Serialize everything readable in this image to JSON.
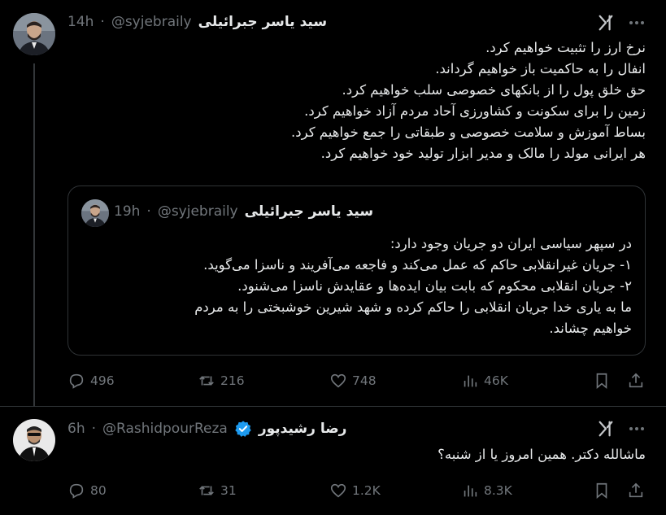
{
  "tweet1": {
    "author_name": "سید یاسر جبرائیلی",
    "handle": "@syjebraily",
    "separator": "·",
    "time": "14h",
    "lines": [
      "نرخ ارز را تثبیت خواهیم کرد.",
      "انفال را به حاکمیت باز خواهیم گرداند.",
      "حق خلق پول را از بانکهای خصوصی سلب خواهیم کرد.",
      "زمین را برای سکونت و کشاورزی آحاد مردم آزاد خواهیم کرد.",
      "بساط آموزش و سلامت خصوصی و طبقاتی را جمع خواهیم کرد.",
      "هر ایرانی مولد را مالک و مدیر ابزار تولید خود خواهیم کرد."
    ],
    "quote": {
      "author_name": "سید یاسر جبرائیلی",
      "handle": "@syjebraily",
      "separator": "·",
      "time": "19h",
      "lines": [
        "در سپهر سیاسی ایران دو جریان وجود دارد:",
        "۱- جریان غیرانقلابی حاکم که عمل می‌کند و فاجعه می‌آفریند و ناسزا می‌گوید.",
        "۲- جریان انقلابی محکوم که بابت بیان ایده‌ها و عقایدش ناسزا می‌شنود.",
        "ما به یاری خدا جریان انقلابی را حاکم کرده و شهد شیرین خوشبختی را به مردم",
        "خواهیم چشاند."
      ]
    },
    "actions": {
      "replies": "496",
      "reposts": "216",
      "likes": "748",
      "views": "46K"
    }
  },
  "tweet2": {
    "author_name": "رضا رشیدپور",
    "handle": "@RashidpourReza",
    "separator": "·",
    "time": "6h",
    "text": "ماشالله دکتر. همین امروز یا از شنبه؟",
    "actions": {
      "replies": "80",
      "reposts": "31",
      "likes": "1.2K",
      "views": "8.3K"
    }
  },
  "icons": {
    "reply": "reply-icon",
    "repost": "repost-icon",
    "like": "like-icon",
    "views": "views-icon",
    "bookmark": "bookmark-icon",
    "share": "share-icon",
    "grok": "grok-icon",
    "more": "more-icon",
    "verified": "verified-badge-icon"
  },
  "colors": {
    "background": "#000000",
    "text": "#e7e9ea",
    "muted": "#71767b",
    "border": "#2f3336",
    "verified": "#1d9bf0"
  }
}
